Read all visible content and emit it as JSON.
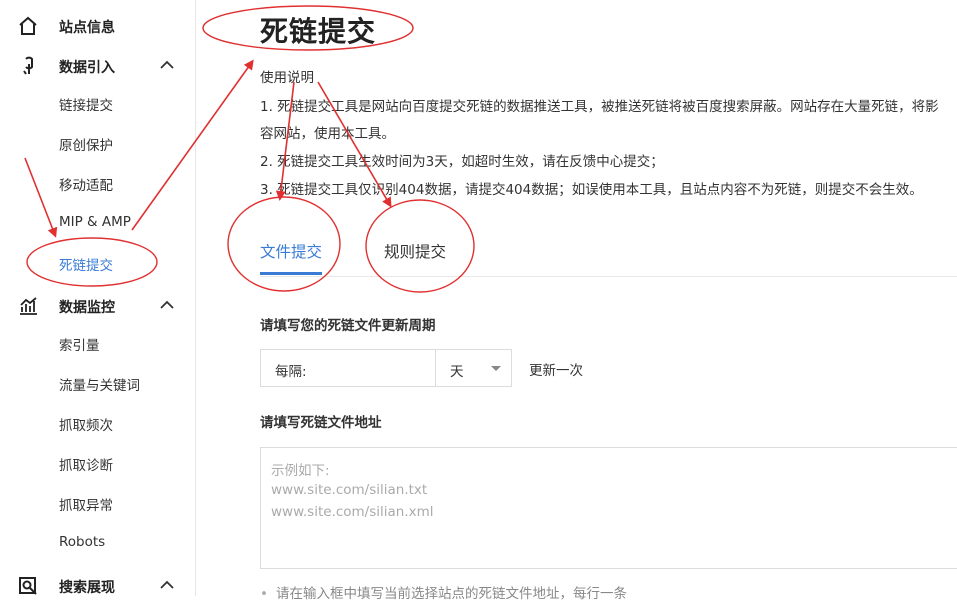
{
  "sidebar": {
    "groups": [
      {
        "label": "站点信息"
      },
      {
        "label": "数据引入",
        "items": [
          "链接提交",
          "原创保护",
          "移动适配",
          "MIP & AMP",
          "死链提交"
        ]
      },
      {
        "label": "数据监控",
        "items": [
          "索引量",
          "流量与关键词",
          "抓取频次",
          "抓取诊断",
          "抓取异常",
          "Robots"
        ]
      },
      {
        "label": "搜索展现"
      }
    ]
  },
  "main": {
    "title": "死链提交",
    "usage_heading": "使用说明",
    "usage_lines": [
      "1. 死链提交工具是网站向百度提交死链的数据推送工具，被推送死链将被百度搜索屏蔽。网站存在大量死链，将影",
      "容网站，使用本工具。",
      "2. 死链提交工具生效时间为3天，如超时生效，请在反馈中心提交；",
      "3. 死链提交工具仅识别404数据，请提交404数据；如误使用本工具，且站点内容不为死链，则提交不会生效。"
    ],
    "tabs": [
      "文件提交",
      "规则提交"
    ],
    "period": {
      "section_label": "请填写您的死链文件更新周期",
      "prefix": "每隔:",
      "unit": "天",
      "suffix": "更新一次"
    },
    "file_url": {
      "section_label": "请填写死链文件地址",
      "placeholder_lines": [
        "示例如下:",
        "www.site.com/silian.txt",
        "www.site.com/silian.xml"
      ]
    },
    "hint": "请在输入框中填写当前选择站点的死链文件地址，每行一条"
  },
  "colors": {
    "accent": "#3a7bd5",
    "annotation": "#e03030"
  }
}
